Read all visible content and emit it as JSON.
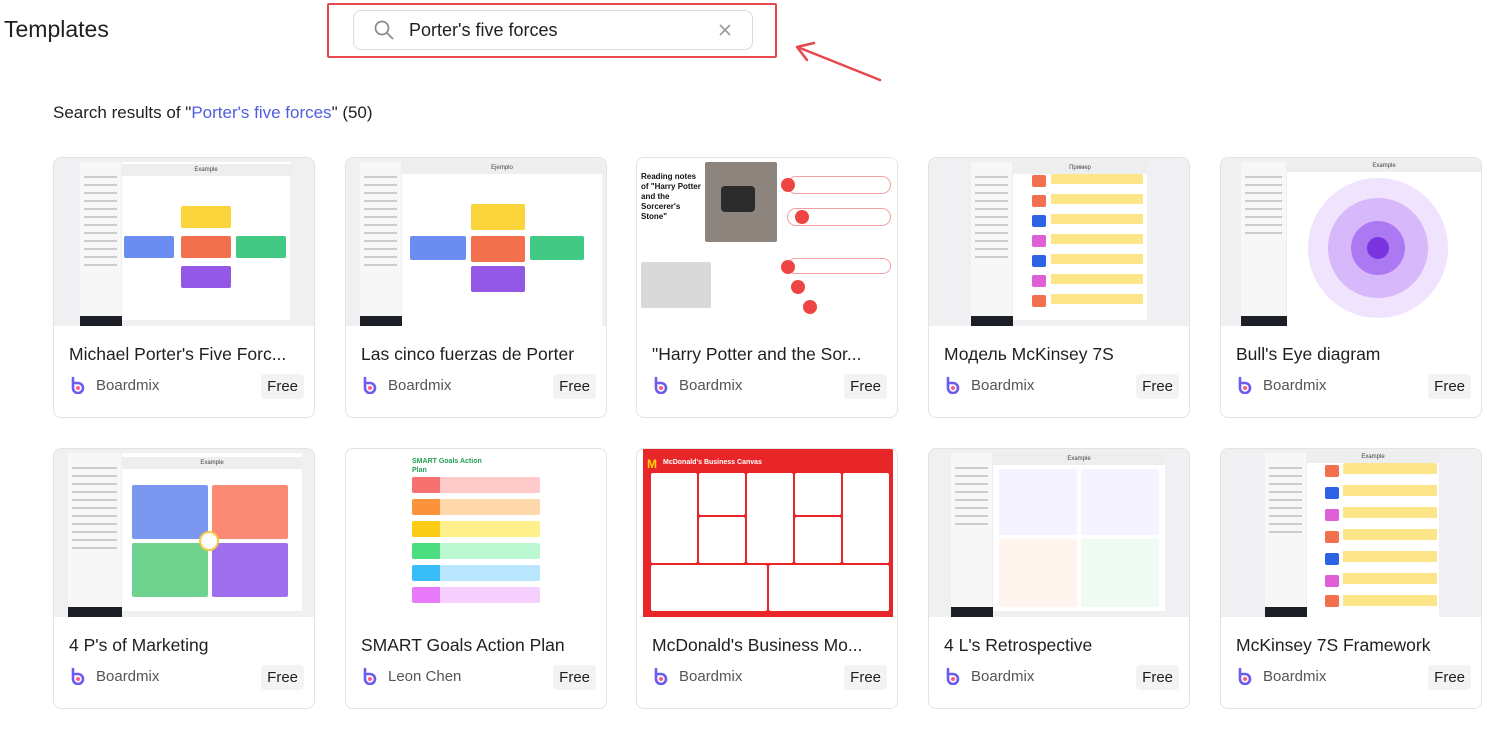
{
  "page": {
    "title": "Templates"
  },
  "search": {
    "value": "Porter's five forces"
  },
  "results": {
    "prefix": "Search results of \"",
    "query": "Porter's five forces",
    "suffix": "\" (50)"
  },
  "cards": [
    {
      "title": "Michael Porter's Five Forc...",
      "author": "Boardmix",
      "badge": "Free",
      "thumb_label": "Example"
    },
    {
      "title": "Las cinco fuerzas de Porter",
      "author": "Boardmix",
      "badge": "Free",
      "thumb_label": "Ejemplo"
    },
    {
      "title": "\"Harry Potter and the Sor...",
      "author": "Boardmix",
      "badge": "Free",
      "thumb_label": "Reading notes of \"Harry Potter and the Sorcerer's Stone\""
    },
    {
      "title": "Модель McKinsey 7S",
      "author": "Boardmix",
      "badge": "Free",
      "thumb_label": "Пример"
    },
    {
      "title": "Bull's Eye diagram",
      "author": "Boardmix",
      "badge": "Free",
      "thumb_label": "Example"
    },
    {
      "title": "4 P's of Marketing",
      "author": "Boardmix",
      "badge": "Free",
      "thumb_label": "Example"
    },
    {
      "title": "SMART Goals Action Plan",
      "author": "Leon Chen",
      "badge": "Free",
      "thumb_label": "SMART Goals Action Plan"
    },
    {
      "title": "McDonald's Business Mo...",
      "author": "Boardmix",
      "badge": "Free",
      "thumb_label": "McDonald's Business Canvas"
    },
    {
      "title": "4 L's Retrospective",
      "author": "Boardmix",
      "badge": "Free",
      "thumb_label": "Example"
    },
    {
      "title": "McKinsey 7S Framework",
      "author": "Boardmix",
      "badge": "Free",
      "thumb_label": "Example"
    }
  ],
  "colors": {
    "highlight": "#e5484d",
    "link": "#4f5ee0",
    "card_border": "#e3e3e3"
  }
}
